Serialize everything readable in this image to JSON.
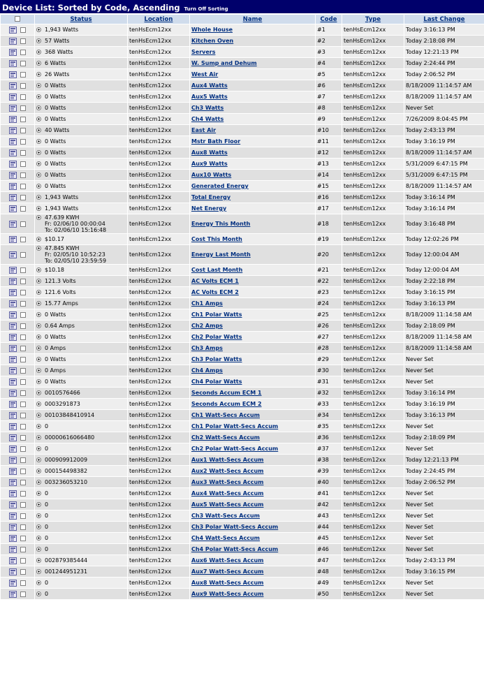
{
  "header": {
    "title": "Device List: Sorted by Code, Ascending",
    "sort_toggle": "Turn Off Sorting"
  },
  "columns": {
    "status": "Status",
    "location": "Location",
    "name": "Name",
    "code": "Code",
    "type": "Type",
    "last_change": "Last Change"
  },
  "rows": [
    {
      "status": "1,943 Watts",
      "location": "tenHsEcm12xx",
      "name": "Whole House",
      "code": "#1",
      "type": "tenHsEcm12xx",
      "last_change": "Today 3:16:13 PM"
    },
    {
      "status": "57 Watts",
      "location": "tenHsEcm12xx",
      "name": "Kitchen Oven",
      "code": "#2",
      "type": "tenHsEcm12xx",
      "last_change": "Today 2:18:08 PM"
    },
    {
      "status": "368 Watts",
      "location": "tenHsEcm12xx",
      "name": "Servers",
      "code": "#3",
      "type": "tenHsEcm12xx",
      "last_change": "Today 12:21:13 PM"
    },
    {
      "status": "6 Watts",
      "location": "tenHsEcm12xx",
      "name": "W. Sump and Dehum",
      "code": "#4",
      "type": "tenHsEcm12xx",
      "last_change": "Today 2:24:44 PM"
    },
    {
      "status": "26 Watts",
      "location": "tenHsEcm12xx",
      "name": "West Air",
      "code": "#5",
      "type": "tenHsEcm12xx",
      "last_change": "Today 2:06:52 PM"
    },
    {
      "status": "0 Watts",
      "location": "tenHsEcm12xx",
      "name": "Aux4 Watts",
      "code": "#6",
      "type": "tenHsEcm12xx",
      "last_change": "8/18/2009 11:14:57 AM"
    },
    {
      "status": "0 Watts",
      "location": "tenHsEcm12xx",
      "name": "Aux5 Watts",
      "code": "#7",
      "type": "tenHsEcm12xx",
      "last_change": "8/18/2009 11:14:57 AM"
    },
    {
      "status": "0 Watts",
      "location": "tenHsEcm12xx",
      "name": "Ch3 Watts",
      "code": "#8",
      "type": "tenHsEcm12xx",
      "last_change": "Never Set"
    },
    {
      "status": "0 Watts",
      "location": "tenHsEcm12xx",
      "name": "Ch4 Watts",
      "code": "#9",
      "type": "tenHsEcm12xx",
      "last_change": "7/26/2009 8:04:45 PM"
    },
    {
      "status": "40 Watts",
      "location": "tenHsEcm12xx",
      "name": "East Air",
      "code": "#10",
      "type": "tenHsEcm12xx",
      "last_change": "Today 2:43:13 PM"
    },
    {
      "status": "0 Watts",
      "location": "tenHsEcm12xx",
      "name": "Mstr Bath Floor",
      "code": "#11",
      "type": "tenHsEcm12xx",
      "last_change": "Today 3:16:19 PM"
    },
    {
      "status": "0 Watts",
      "location": "tenHsEcm12xx",
      "name": "Aux8 Watts",
      "code": "#12",
      "type": "tenHsEcm12xx",
      "last_change": "8/18/2009 11:14:57 AM"
    },
    {
      "status": "0 Watts",
      "location": "tenHsEcm12xx",
      "name": "Aux9 Watts",
      "code": "#13",
      "type": "tenHsEcm12xx",
      "last_change": "5/31/2009 6:47:15 PM"
    },
    {
      "status": "0 Watts",
      "location": "tenHsEcm12xx",
      "name": "Aux10 Watts",
      "code": "#14",
      "type": "tenHsEcm12xx",
      "last_change": "5/31/2009 6:47:15 PM"
    },
    {
      "status": "0 Watts",
      "location": "tenHsEcm12xx",
      "name": "Generated Energy",
      "code": "#15",
      "type": "tenHsEcm12xx",
      "last_change": "8/18/2009 11:14:57 AM"
    },
    {
      "status": "1,943 Watts",
      "location": "tenHsEcm12xx",
      "name": "Total Energy",
      "code": "#16",
      "type": "tenHsEcm12xx",
      "last_change": "Today 3:16:14 PM"
    },
    {
      "status": "1,943 Watts",
      "location": "tenHsEcm12xx",
      "name": "Net Energy",
      "code": "#17",
      "type": "tenHsEcm12xx",
      "last_change": "Today 3:16:14 PM"
    },
    {
      "status": "47.639 KWH",
      "status_from": "Fr: 02/06/10 00:00:04",
      "status_to": "To: 02/06/10 15:16:48",
      "location": "tenHsEcm12xx",
      "name": "Energy This Month",
      "code": "#18",
      "type": "tenHsEcm12xx",
      "last_change": "Today 3:16:48 PM"
    },
    {
      "status": "$10.17",
      "location": "tenHsEcm12xx",
      "name": "Cost This Month",
      "code": "#19",
      "type": "tenHsEcm12xx",
      "last_change": "Today 12:02:26 PM"
    },
    {
      "status": "47.845 KWH",
      "status_from": "Fr: 02/05/10 10:52:23",
      "status_to": "To: 02/05/10 23:59:59",
      "location": "tenHsEcm12xx",
      "name": "Energy Last Month",
      "code": "#20",
      "type": "tenHsEcm12xx",
      "last_change": "Today 12:00:04 AM"
    },
    {
      "status": "$10.18",
      "location": "tenHsEcm12xx",
      "name": "Cost Last Month",
      "code": "#21",
      "type": "tenHsEcm12xx",
      "last_change": "Today 12:00:04 AM"
    },
    {
      "status": "121.3 Volts",
      "location": "tenHsEcm12xx",
      "name": "AC Volts ECM 1",
      "code": "#22",
      "type": "tenHsEcm12xx",
      "last_change": "Today 2:22:18 PM"
    },
    {
      "status": "121.6 Volts",
      "location": "tenHsEcm12xx",
      "name": "AC Volts ECM 2",
      "code": "#23",
      "type": "tenHsEcm12xx",
      "last_change": "Today 3:16:15 PM"
    },
    {
      "status": "15.77 Amps",
      "location": "tenHsEcm12xx",
      "name": "Ch1 Amps",
      "code": "#24",
      "type": "tenHsEcm12xx",
      "last_change": "Today 3:16:13 PM"
    },
    {
      "status": "0 Watts",
      "location": "tenHsEcm12xx",
      "name": "Ch1 Polar Watts",
      "code": "#25",
      "type": "tenHsEcm12xx",
      "last_change": "8/18/2009 11:14:58 AM"
    },
    {
      "status": "0.64 Amps",
      "location": "tenHsEcm12xx",
      "name": "Ch2 Amps",
      "code": "#26",
      "type": "tenHsEcm12xx",
      "last_change": "Today 2:18:09 PM"
    },
    {
      "status": "0 Watts",
      "location": "tenHsEcm12xx",
      "name": "Ch2 Polar Watts",
      "code": "#27",
      "type": "tenHsEcm12xx",
      "last_change": "8/18/2009 11:14:58 AM"
    },
    {
      "status": "0 Amps",
      "location": "tenHsEcm12xx",
      "name": "Ch3 Amps",
      "code": "#28",
      "type": "tenHsEcm12xx",
      "last_change": "8/18/2009 11:14:58 AM"
    },
    {
      "status": "0 Watts",
      "location": "tenHsEcm12xx",
      "name": "Ch3 Polar Watts",
      "code": "#29",
      "type": "tenHsEcm12xx",
      "last_change": "Never Set"
    },
    {
      "status": "0 Amps",
      "location": "tenHsEcm12xx",
      "name": "Ch4 Amps",
      "code": "#30",
      "type": "tenHsEcm12xx",
      "last_change": "Never Set"
    },
    {
      "status": "0 Watts",
      "location": "tenHsEcm12xx",
      "name": "Ch4 Polar Watts",
      "code": "#31",
      "type": "tenHsEcm12xx",
      "last_change": "Never Set"
    },
    {
      "status": "0010576466",
      "location": "tenHsEcm12xx",
      "name": "Seconds Accum ECM 1",
      "code": "#32",
      "type": "tenHsEcm12xx",
      "last_change": "Today 3:16:14 PM"
    },
    {
      "status": "0003291873",
      "location": "tenHsEcm12xx",
      "name": "Seconds Accum ECM 2",
      "code": "#33",
      "type": "tenHsEcm12xx",
      "last_change": "Today 3:16:19 PM"
    },
    {
      "status": "00103848410914",
      "location": "tenHsEcm12xx",
      "name": "Ch1 Watt-Secs Accum",
      "code": "#34",
      "type": "tenHsEcm12xx",
      "last_change": "Today 3:16:13 PM"
    },
    {
      "status": "0",
      "location": "tenHsEcm12xx",
      "name": "Ch1 Polar Watt-Secs Accum",
      "code": "#35",
      "type": "tenHsEcm12xx",
      "last_change": "Never Set"
    },
    {
      "status": "00000616066480",
      "location": "tenHsEcm12xx",
      "name": "Ch2 Watt-Secs Accum",
      "code": "#36",
      "type": "tenHsEcm12xx",
      "last_change": "Today 2:18:09 PM"
    },
    {
      "status": "0",
      "location": "tenHsEcm12xx",
      "name": "Ch2 Polar Watt-Secs Accum",
      "code": "#37",
      "type": "tenHsEcm12xx",
      "last_change": "Never Set"
    },
    {
      "status": "000909912009",
      "location": "tenHsEcm12xx",
      "name": "Aux1 Watt-Secs Accum",
      "code": "#38",
      "type": "tenHsEcm12xx",
      "last_change": "Today 12:21:13 PM"
    },
    {
      "status": "000154498382",
      "location": "tenHsEcm12xx",
      "name": "Aux2 Watt-Secs Accum",
      "code": "#39",
      "type": "tenHsEcm12xx",
      "last_change": "Today 2:24:45 PM"
    },
    {
      "status": "003236053210",
      "location": "tenHsEcm12xx",
      "name": "Aux3 Watt-Secs Accum",
      "code": "#40",
      "type": "tenHsEcm12xx",
      "last_change": "Today 2:06:52 PM"
    },
    {
      "status": "0",
      "location": "tenHsEcm12xx",
      "name": "Aux4 Watt-Secs Accum",
      "code": "#41",
      "type": "tenHsEcm12xx",
      "last_change": "Never Set"
    },
    {
      "status": "0",
      "location": "tenHsEcm12xx",
      "name": "Aux5 Watt-Secs Accum",
      "code": "#42",
      "type": "tenHsEcm12xx",
      "last_change": "Never Set"
    },
    {
      "status": "0",
      "location": "tenHsEcm12xx",
      "name": "Ch3 Watt-Secs Accum",
      "code": "#43",
      "type": "tenHsEcm12xx",
      "last_change": "Never Set"
    },
    {
      "status": "0",
      "location": "tenHsEcm12xx",
      "name": "Ch3 Polar Watt-Secs Accum",
      "code": "#44",
      "type": "tenHsEcm12xx",
      "last_change": "Never Set"
    },
    {
      "status": "0",
      "location": "tenHsEcm12xx",
      "name": "Ch4 Watt-Secs Accum",
      "code": "#45",
      "type": "tenHsEcm12xx",
      "last_change": "Never Set"
    },
    {
      "status": "0",
      "location": "tenHsEcm12xx",
      "name": "Ch4 Polar Watt-Secs Accum",
      "code": "#46",
      "type": "tenHsEcm12xx",
      "last_change": "Never Set"
    },
    {
      "status": "002879385444",
      "location": "tenHsEcm12xx",
      "name": "Aux6 Watt-Secs Accum",
      "code": "#47",
      "type": "tenHsEcm12xx",
      "last_change": "Today 2:43:13 PM"
    },
    {
      "status": "001244951231",
      "location": "tenHsEcm12xx",
      "name": "Aux7 Watt-Secs Accum",
      "code": "#48",
      "type": "tenHsEcm12xx",
      "last_change": "Today 3:16:15 PM"
    },
    {
      "status": "0",
      "location": "tenHsEcm12xx",
      "name": "Aux8 Watt-Secs Accum",
      "code": "#49",
      "type": "tenHsEcm12xx",
      "last_change": "Never Set"
    },
    {
      "status": "0",
      "location": "tenHsEcm12xx",
      "name": "Aux9 Watt-Secs Accum",
      "code": "#50",
      "type": "tenHsEcm12xx",
      "last_change": "Never Set"
    }
  ]
}
